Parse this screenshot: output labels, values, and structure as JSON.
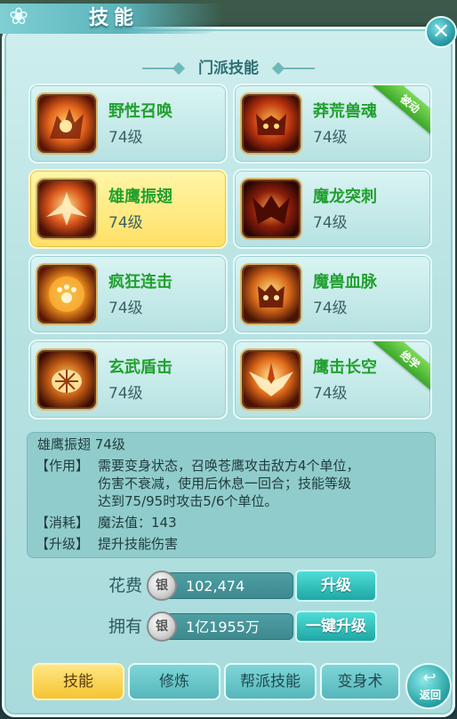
{
  "window": {
    "title": "技能",
    "close_icon": "close-x-icon"
  },
  "section": {
    "title": "门派技能"
  },
  "skills": [
    {
      "name": "野性召唤",
      "level": "74级",
      "badge": "",
      "icon": "wild-beast-icon"
    },
    {
      "name": "莽荒兽魂",
      "level": "74级",
      "badge": "被动",
      "icon": "beast-soul-icon"
    },
    {
      "name": "雄鹰振翅",
      "level": "74级",
      "badge": "",
      "icon": "eagle-wing-icon",
      "selected": true
    },
    {
      "name": "魔龙突刺",
      "level": "74级",
      "badge": "",
      "icon": "demon-dragon-icon"
    },
    {
      "name": "疯狂连击",
      "level": "74级",
      "badge": "",
      "icon": "paw-strike-icon"
    },
    {
      "name": "魔兽血脉",
      "level": "74级",
      "badge": "",
      "icon": "beast-blood-icon"
    },
    {
      "name": "玄武盾击",
      "level": "74级",
      "badge": "",
      "icon": "shell-shield-icon"
    },
    {
      "name": "鹰击长空",
      "level": "74级",
      "badge": "绝学",
      "icon": "eagle-sky-icon"
    }
  ],
  "description": {
    "title": "雄鹰振翅 74级",
    "effect_label": "【作用】",
    "effect_lines": [
      "需要变身状态，召唤苍鹰攻击敌方4个单位，",
      "伤害不衰减，使用后休息一回合；技能等级",
      "达到75/95时攻击5/6个单位。"
    ],
    "cost_label": "【消耗】",
    "cost_text": "魔法值：143",
    "upgrade_label": "【升级】",
    "upgrade_text": "提升技能伤害"
  },
  "cost": {
    "label": "花费",
    "value": "102,474",
    "coin_glyph": "银",
    "button": "升级"
  },
  "owned": {
    "label": "拥有",
    "value": "1亿1955万",
    "coin_glyph": "银",
    "button": "一键升级"
  },
  "tabs": [
    {
      "label": "技能",
      "active": true
    },
    {
      "label": "修炼"
    },
    {
      "label": "帮派技能"
    },
    {
      "label": "变身术"
    }
  ],
  "return_button": {
    "label": "返回"
  },
  "colors": {
    "skill_name": "#22a030",
    "selected_card": "#ffe066",
    "badge_green": "#3aa82a",
    "panel": "#b7e2e2"
  }
}
